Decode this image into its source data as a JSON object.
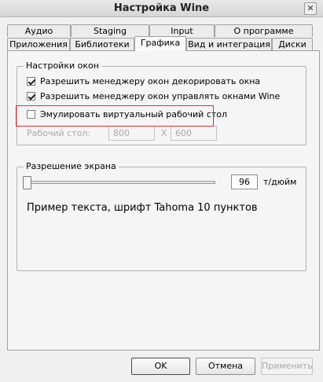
{
  "window": {
    "title": "Настройка Wine",
    "close_glyph": "✕"
  },
  "tabs_row1": [
    {
      "label": "Аудио"
    },
    {
      "label": "Staging"
    },
    {
      "label": "Input"
    },
    {
      "label": "О программе"
    }
  ],
  "tabs_row2": [
    {
      "label": "Приложения"
    },
    {
      "label": "Библиотеки"
    },
    {
      "label": "Графика",
      "active": true
    },
    {
      "label": "Вид и интеграция"
    },
    {
      "label": "Диски"
    }
  ],
  "window_settings": {
    "title": "Настройки окон",
    "decorate": {
      "label": "Разрешить менеджеру окон декорировать окна",
      "checked": true
    },
    "manage": {
      "label": "Разрешить менеджеру окон управлять окнами Wine",
      "checked": true
    },
    "virtual_desktop": {
      "label": "Эмулировать виртуальный рабочий стол",
      "checked": false
    },
    "desktop_label": "Рабочий стол:",
    "width": "800",
    "times": "X",
    "height": "600"
  },
  "screen_resolution": {
    "title": "Разрешение экрана",
    "dpi_value": "96",
    "dpi_unit": "т/дюйм",
    "sample_text": "Пример текста, шрифт Tahoma 10 пунктов"
  },
  "buttons": {
    "ok": "OK",
    "cancel": "Отмена",
    "apply": "Применить"
  },
  "colors": {
    "highlight": "#e03030"
  }
}
